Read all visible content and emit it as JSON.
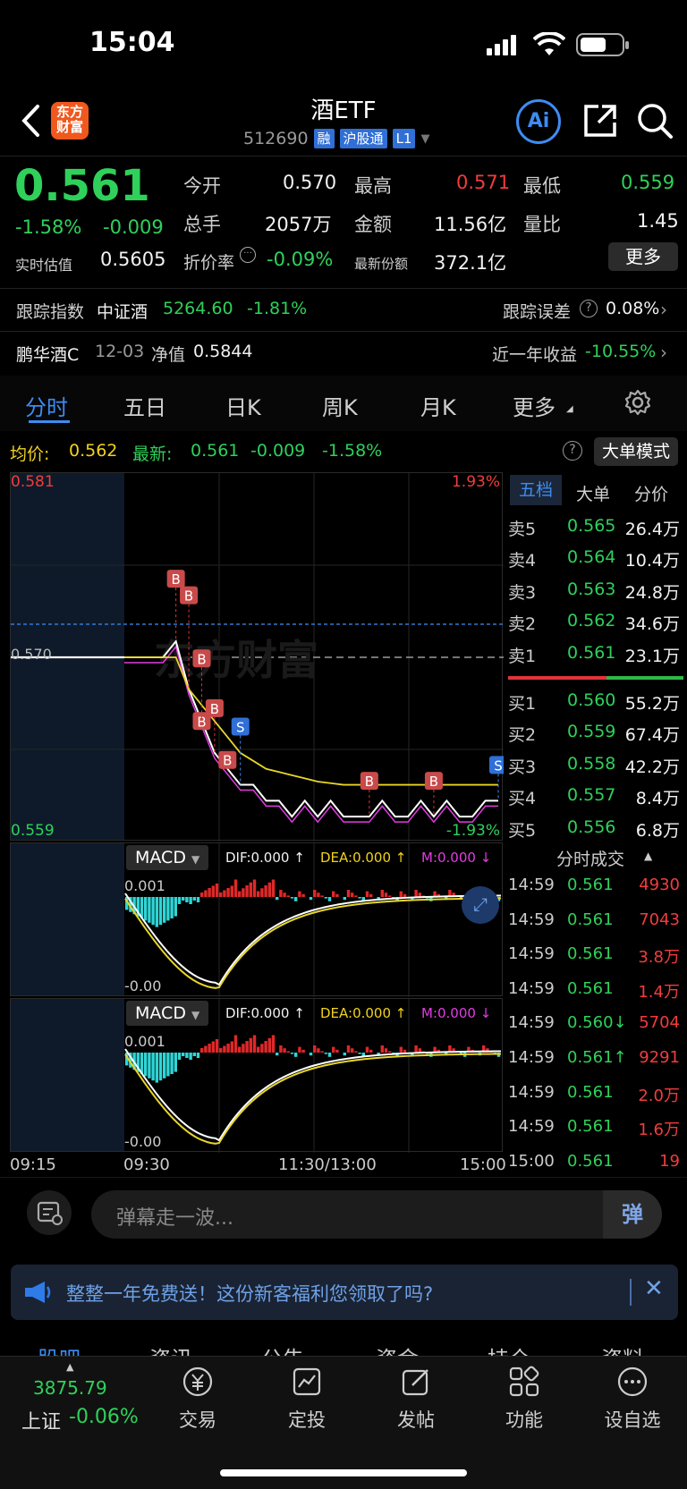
{
  "status_bar": {
    "time": "15:04"
  },
  "header": {
    "logo_text": "东方财富",
    "title": "酒ETF",
    "code": "512690",
    "tags": [
      "融",
      "沪股通",
      "L1"
    ]
  },
  "quote": {
    "price": "0.561",
    "change_pct": "-1.58%",
    "change": "-0.009",
    "est_label": "实时估值",
    "est_value": "0.5605",
    "open_label": "今开",
    "open": "0.570",
    "high_label": "最高",
    "high": "0.571",
    "low_label": "最低",
    "low": "0.559",
    "volume_label": "总手",
    "volume": "2057万",
    "amount_label": "金额",
    "amount": "11.56亿",
    "ratio_label": "量比",
    "ratio": "1.45",
    "discount_label": "折价率",
    "discount": "-0.09%",
    "shares_label": "最新份额",
    "shares": "372.1亿",
    "more_label": "更多"
  },
  "tracking": {
    "index_label": "跟踪指数",
    "index_name": "中证酒",
    "index_value": "5264.60",
    "index_change": "-1.81%",
    "error_label": "跟踪误差",
    "error_value": "0.08%",
    "fund_name": "鹏华酒C",
    "fund_date": "12-03",
    "nav_label": "净值",
    "nav_value": "0.5844",
    "return_label": "近一年收益",
    "return_value": "-10.55%"
  },
  "tabs": [
    "分时",
    "五日",
    "日K",
    "周K",
    "月K",
    "更多"
  ],
  "chart_info": {
    "avg_label": "均价:",
    "avg_value": "0.562",
    "latest_label": "最新:",
    "latest_price": "0.561",
    "latest_change": "-0.009",
    "latest_pct": "-1.58%",
    "mode_label": "大单模式"
  },
  "chart_axis": {
    "y_top": "0.581",
    "y_mid": "0.570",
    "y_bottom": "0.559",
    "pct_top": "1.93%",
    "pct_bottom": "-1.93%",
    "watermark": "东方财富",
    "x_labels": [
      "09:15",
      "09:30",
      "11:30/13:00",
      "15:00"
    ]
  },
  "chart_data": {
    "type": "line",
    "title": "",
    "ylim": [
      0.559,
      0.581
    ],
    "series": [
      {
        "values": [
          0.57,
          0.57,
          0.57,
          0.57,
          0.571,
          0.568,
          0.566,
          0.564,
          0.563,
          0.562,
          0.562,
          0.561,
          0.561,
          0.56,
          0.561,
          0.56,
          0.561,
          0.56,
          0.56,
          0.56,
          0.561,
          0.56,
          0.56,
          0.561,
          0.56,
          0.561,
          0.56,
          0.56,
          0.561,
          0.561
        ]
      },
      {
        "values": [
          0.57,
          0.57,
          0.57,
          0.57,
          0.57,
          0.568,
          0.567,
          0.566,
          0.565,
          0.564,
          0.5635,
          0.563,
          0.5628,
          0.5626,
          0.5624,
          0.5622,
          0.5621,
          0.562,
          0.562,
          0.562,
          0.562,
          0.562,
          0.562,
          0.562,
          0.562,
          0.562,
          0.562,
          0.562,
          0.562,
          0.562
        ]
      }
    ],
    "markers": [
      "B",
      "B",
      "B",
      "B",
      "B",
      "B",
      "S",
      "B",
      "B",
      "S"
    ]
  },
  "orderbook": {
    "tabs": [
      "五档",
      "大单",
      "分价"
    ],
    "asks": [
      {
        "label": "卖5",
        "price": "0.565",
        "vol": "26.4万"
      },
      {
        "label": "卖4",
        "price": "0.564",
        "vol": "10.4万"
      },
      {
        "label": "卖3",
        "price": "0.563",
        "vol": "24.8万"
      },
      {
        "label": "卖2",
        "price": "0.562",
        "vol": "34.6万"
      },
      {
        "label": "卖1",
        "price": "0.561",
        "vol": "23.1万"
      }
    ],
    "bids": [
      {
        "label": "买1",
        "price": "0.560",
        "vol": "55.2万"
      },
      {
        "label": "买2",
        "price": "0.559",
        "vol": "67.4万"
      },
      {
        "label": "买3",
        "price": "0.558",
        "vol": "42.2万"
      },
      {
        "label": "买4",
        "price": "0.557",
        "vol": "8.4万"
      },
      {
        "label": "买5",
        "price": "0.556",
        "vol": "6.8万"
      }
    ]
  },
  "ticks": {
    "title": "分时成交",
    "rows": [
      {
        "time": "14:59",
        "price": "0.561",
        "vol": "4930"
      },
      {
        "time": "14:59",
        "price": "0.561",
        "vol": "7043"
      },
      {
        "time": "14:59",
        "price": "0.561",
        "vol": "3.8万"
      },
      {
        "time": "14:59",
        "price": "0.561",
        "vol": "1.4万"
      },
      {
        "time": "14:59",
        "price": "0.560↓",
        "vol": "5704"
      },
      {
        "time": "14:59",
        "price": "0.561↑",
        "vol": "9291"
      },
      {
        "time": "14:59",
        "price": "0.561",
        "vol": "2.0万"
      },
      {
        "time": "14:59",
        "price": "0.561",
        "vol": "1.6万"
      },
      {
        "time": "15:00",
        "price": "0.561",
        "vol": "19"
      }
    ]
  },
  "macd": {
    "label": "MACD",
    "dif": "DIF:0.000 ↑",
    "dea": "DEA:0.000 ↑",
    "m": "M:0.000 ↓",
    "top": "0.001",
    "bottom": "-0.00"
  },
  "danmaku": {
    "placeholder": "弹幕走一波...",
    "button": "弹"
  },
  "banner": {
    "text": "整整一年免费送！这份新客福利您领取了吗?"
  },
  "sub_tabs": [
    "股吧",
    "资讯",
    "公告",
    "资金",
    "持仓",
    "资料"
  ],
  "bottom_nav": {
    "index_value": "3875.79",
    "index_name": "上证",
    "index_change": "-0.06%",
    "items": [
      "交易",
      "定投",
      "发帖",
      "功能",
      "设自选"
    ]
  }
}
